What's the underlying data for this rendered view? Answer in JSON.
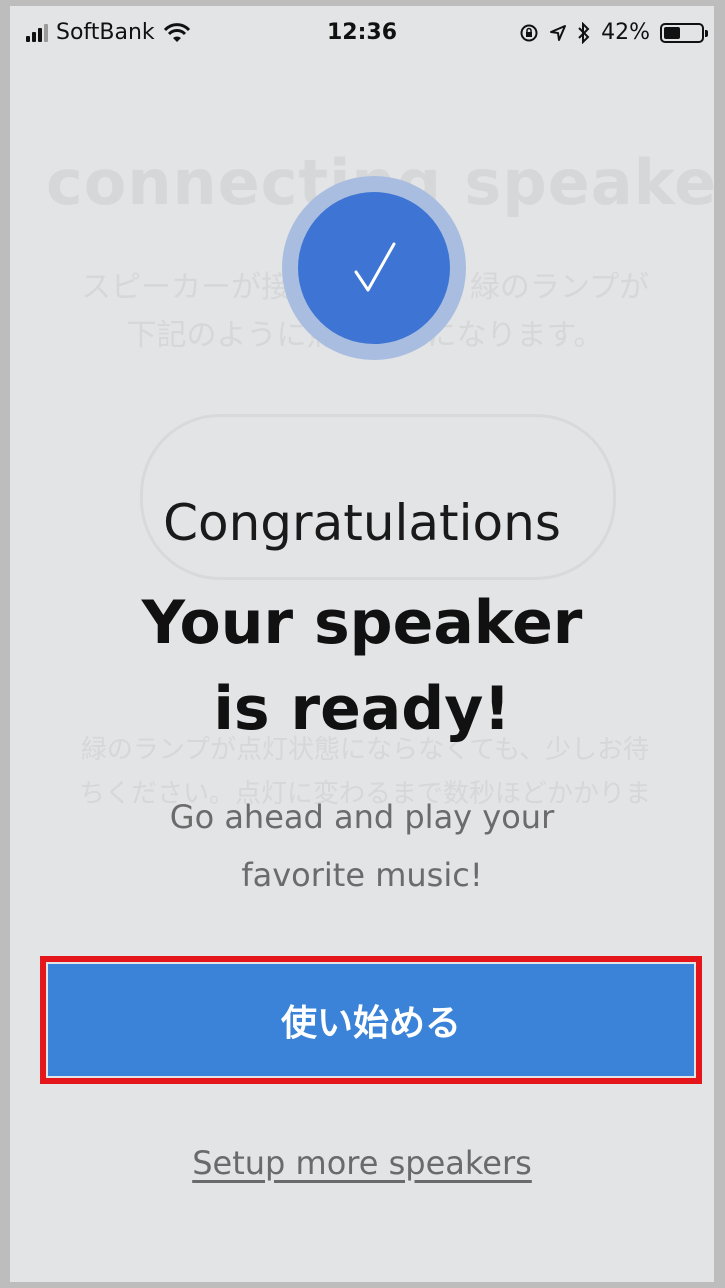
{
  "status_bar": {
    "carrier": "SoftBank",
    "time": "12:36",
    "battery_percent": "42%",
    "icons": [
      "signal-icon",
      "wifi-icon",
      "orientation-lock-icon",
      "location-icon",
      "bluetooth-icon",
      "battery-icon"
    ]
  },
  "background_page": {
    "title": "connecting speake…",
    "description_line1": "スピーカーが接続されると、緑のランプが",
    "description_line2": "下記のように点灯状態になります。",
    "note_line1": "緑のランプが点灯状態にならなくても、少しお待",
    "note_line2": "ちください。点灯に変わるまで数秒ほどかかりま"
  },
  "main": {
    "congratulations": "Congratulations",
    "headline_line1": "Your speaker",
    "headline_line2": "is ready!",
    "subtitle_line1": "Go ahead and play your",
    "subtitle_line2": "favorite music!",
    "start_button_label": "使い始める",
    "setup_more_link": "Setup more speakers"
  },
  "colors": {
    "accent_blue": "#3a83d8",
    "check_blue": "#3e74d3",
    "highlight_red": "#e5161b"
  }
}
